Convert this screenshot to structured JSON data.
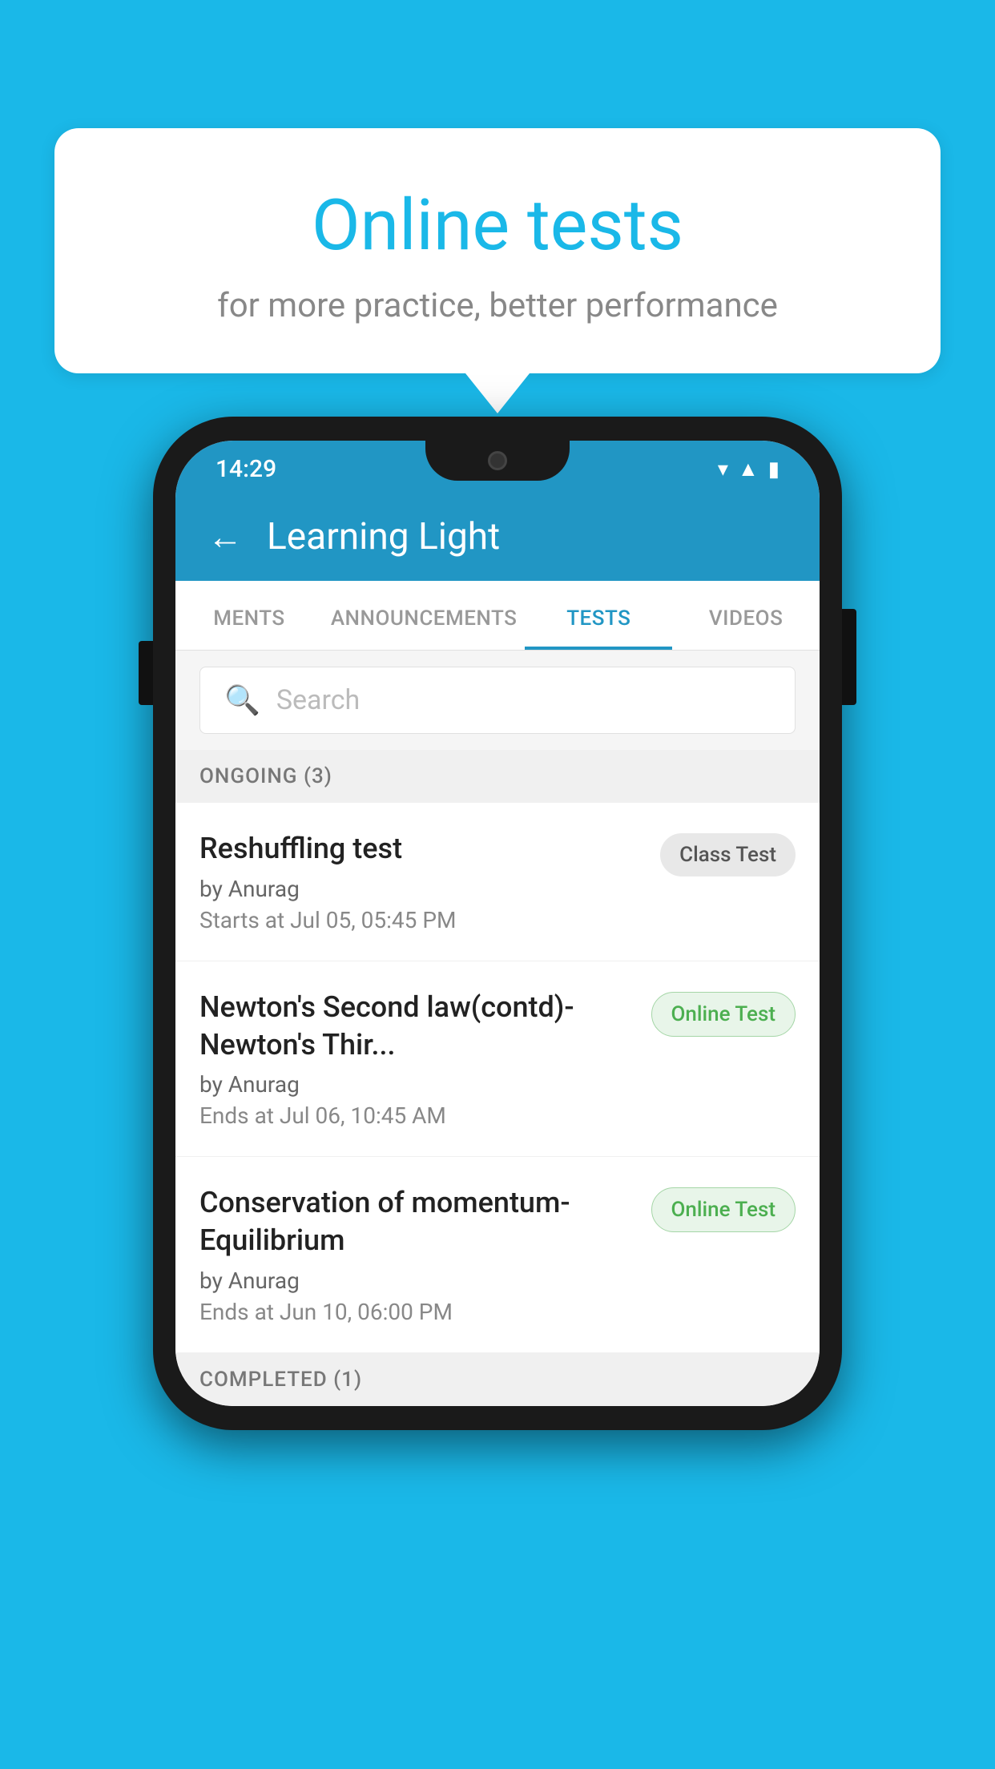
{
  "background_color": "#1ab8e8",
  "speech_bubble": {
    "title": "Online tests",
    "subtitle": "for more practice, better performance"
  },
  "phone": {
    "status_bar": {
      "time": "14:29"
    },
    "header": {
      "title": "Learning Light",
      "back_label": "←"
    },
    "tabs": [
      {
        "label": "MENTS",
        "active": false
      },
      {
        "label": "ANNOUNCEMENTS",
        "active": false
      },
      {
        "label": "TESTS",
        "active": true
      },
      {
        "label": "VIDEOS",
        "active": false
      }
    ],
    "search": {
      "placeholder": "Search",
      "icon": "🔍"
    },
    "ongoing_section": {
      "label": "ONGOING (3)"
    },
    "tests": [
      {
        "title": "Reshuffling test",
        "author": "by Anurag",
        "date": "Starts at  Jul 05, 05:45 PM",
        "badge": "Class Test",
        "badge_type": "class"
      },
      {
        "title": "Newton's Second law(contd)-Newton's Thir...",
        "author": "by Anurag",
        "date": "Ends at  Jul 06, 10:45 AM",
        "badge": "Online Test",
        "badge_type": "online"
      },
      {
        "title": "Conservation of momentum-Equilibrium",
        "author": "by Anurag",
        "date": "Ends at  Jun 10, 06:00 PM",
        "badge": "Online Test",
        "badge_type": "online"
      }
    ],
    "completed_section": {
      "label": "COMPLETED (1)"
    }
  }
}
